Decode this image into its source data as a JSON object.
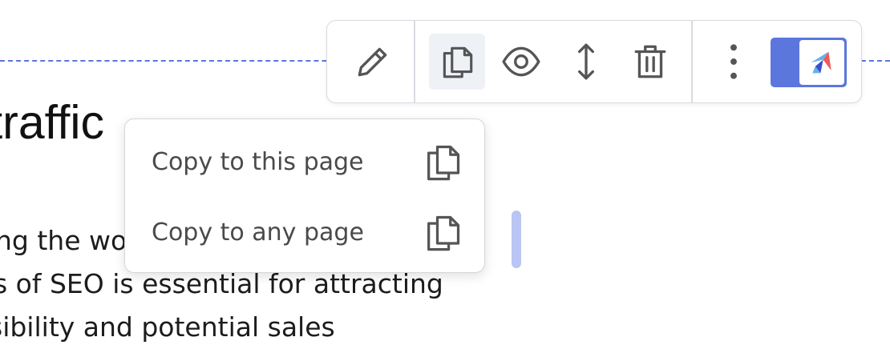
{
  "page": {
    "heading_fragment": "t traffic",
    "paragraph_lines": [
      "ng the world",
      "s of SEO is essential for attracting",
      "sibility and potential sales"
    ]
  },
  "toolbar": {
    "buttons": [
      {
        "name": "edit",
        "icon": "pencil-icon"
      },
      {
        "name": "copy",
        "icon": "copy-icon",
        "active": true
      },
      {
        "name": "preview",
        "icon": "eye-icon"
      },
      {
        "name": "move",
        "icon": "vertical-arrows-icon"
      },
      {
        "name": "delete",
        "icon": "trash-icon"
      },
      {
        "name": "more",
        "icon": "vertical-dots-icon"
      }
    ],
    "brand_icon": "paper-plane-logo-icon"
  },
  "copy_menu": {
    "items": [
      {
        "label": "Copy to this page",
        "icon": "copy-icon"
      },
      {
        "label": "Copy to any page",
        "icon": "copy-icon"
      }
    ]
  },
  "colors": {
    "accent": "#5b77dd",
    "scrollbar": "#b9c6f3",
    "icon": "#555555",
    "active_bg": "#eef1f6",
    "logo_blue": "#63b3ea",
    "logo_red": "#f05a5a",
    "logo_navy": "#3b4ed0"
  }
}
